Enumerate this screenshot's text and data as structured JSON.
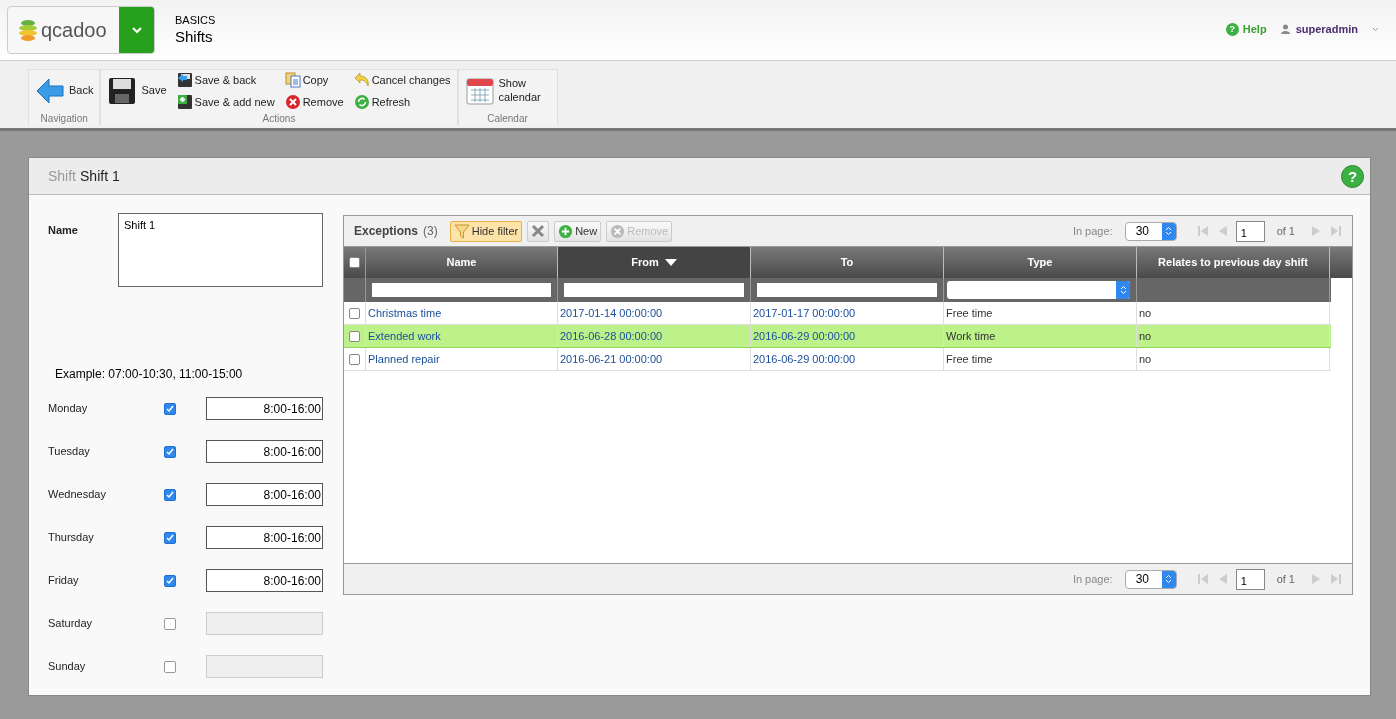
{
  "header": {
    "logo": "qcadoo",
    "category": "BASICS",
    "title": "Shifts",
    "help_mark": "?",
    "help": "Help",
    "user": "superadmin"
  },
  "toolbar": [
    {
      "label": "Navigation",
      "buttons": [
        {
          "kind": "large",
          "label": "Back"
        }
      ]
    },
    {
      "label": "Actions",
      "buttons": [
        {
          "kind": "large",
          "label": "Save"
        },
        {
          "kind": "small",
          "label": "Save & back"
        },
        {
          "kind": "small",
          "label": "Save & add new"
        },
        {
          "kind": "small",
          "label": "Copy"
        },
        {
          "kind": "small",
          "label": "Remove"
        },
        {
          "kind": "small",
          "label": "Cancel changes"
        },
        {
          "kind": "small",
          "label": "Refresh"
        }
      ]
    },
    {
      "label": "Calendar",
      "buttons": [
        {
          "kind": "large",
          "label": "Show calendar"
        }
      ]
    }
  ],
  "form": {
    "entity": "Shift",
    "title": "Shift 1",
    "help_mark": "?",
    "name_label": "Name",
    "name_value": "Shift 1",
    "example": "Example: 07:00-10:30, 11:00-15:00",
    "days": [
      {
        "label": "Monday",
        "checked": true,
        "value": "8:00-16:00"
      },
      {
        "label": "Tuesday",
        "checked": true,
        "value": "8:00-16:00"
      },
      {
        "label": "Wednesday",
        "checked": true,
        "value": "8:00-16:00"
      },
      {
        "label": "Thursday",
        "checked": true,
        "value": "8:00-16:00"
      },
      {
        "label": "Friday",
        "checked": true,
        "value": "8:00-16:00"
      },
      {
        "label": "Saturday",
        "checked": false
      },
      {
        "label": "Sunday",
        "checked": false
      }
    ]
  },
  "grid": {
    "title": "Exceptions",
    "count": "(3)",
    "buttons": [
      {
        "kind": "filter",
        "label": "Hide filter",
        "active": true,
        "disabled": false
      },
      {
        "kind": "clear",
        "active": false,
        "disabled": false
      },
      {
        "kind": "new",
        "label": "New",
        "active": false,
        "disabled": false
      },
      {
        "kind": "remove",
        "label": "Remove",
        "active": false,
        "disabled": true
      }
    ],
    "pagination_top": {
      "label": "In page:",
      "size": "30",
      "page": "1",
      "of": "of 1"
    },
    "pagination_bottom": {
      "label": "In page:",
      "size": "30",
      "page": "1",
      "of": "of 1"
    },
    "all_checked": false,
    "columns": [
      {
        "label": "Name",
        "kind": "link",
        "sorted": false
      },
      {
        "label": "From",
        "kind": "link",
        "sorted": true
      },
      {
        "label": "To",
        "kind": "link",
        "sorted": false
      },
      {
        "label": "Type",
        "kind": "text",
        "sorted": false
      },
      {
        "label": "Relates to previous day shift",
        "kind": "text",
        "sorted": false
      }
    ],
    "rows": [
      {
        "selected": false,
        "checked": false,
        "cells": [
          "Christmas time",
          "2017-01-14 00:00:00",
          "2017-01-17 00:00:00",
          "Free time",
          "no"
        ]
      },
      {
        "selected": true,
        "checked": false,
        "cells": [
          "Extended work",
          "2016-06-28 00:00:00",
          "2016-06-29 00:00:00",
          "Work time",
          "no"
        ]
      },
      {
        "selected": false,
        "checked": false,
        "cells": [
          "Planned repair",
          "2016-06-21 00:00:00",
          "2016-06-29 00:00:00",
          "Free time",
          "no"
        ]
      }
    ]
  }
}
